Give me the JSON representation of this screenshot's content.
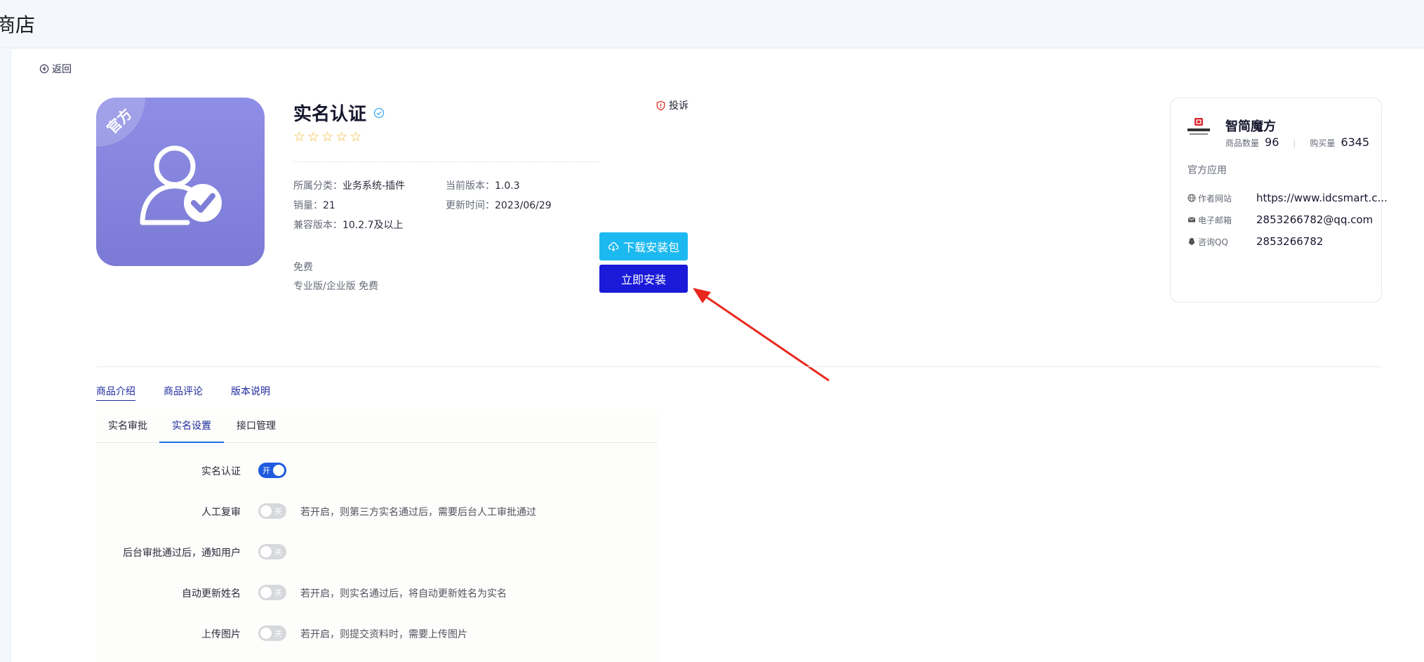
{
  "header": {
    "title": "商店"
  },
  "back": {
    "label": "返回"
  },
  "product": {
    "badge": "官方",
    "title": "实名认证",
    "rating": 0,
    "rating_max": 5,
    "complain_label": "投诉",
    "meta": {
      "category_key": "所属分类：",
      "category_value": "业务系统-插件",
      "version_key": "当前版本：",
      "version_value": "1.0.3",
      "sales_key": "销量：",
      "sales_value": "21",
      "updated_key": "更新时间：",
      "updated_value": "2023/06/29",
      "compat_key": "兼容版本：",
      "compat_value": "10.2.7及以上"
    },
    "price_free": "免费",
    "price_editions": "专业版/企业版 免费",
    "download_label": "下载安装包",
    "install_label": "立即安装"
  },
  "vendor": {
    "name": "智简魔方",
    "products_label": "商品数量",
    "products_count": "96",
    "buyers_label": "购买量",
    "buyers_count": "6345",
    "tag": "官方应用",
    "website_label": "作者网站",
    "website_value": "https://www.idcsmart.c...",
    "email_label": "电子邮箱",
    "email_value": "2853266782@qq.com",
    "qq_label": "咨询QQ",
    "qq_value": "2853266782"
  },
  "tabs": {
    "intro": "商品介绍",
    "reviews": "商品评论",
    "changelog": "版本说明"
  },
  "subtabs": {
    "approve": "实名审批",
    "settings": "实名设置",
    "api": "接口管理"
  },
  "settings": [
    {
      "label": "实名认证",
      "state": "开",
      "hint": ""
    },
    {
      "label": "人工复审",
      "state": "关",
      "hint": "若开启，则第三方实名通过后，需要后台人工审批通过"
    },
    {
      "label": "后台审批通过后，通知用户",
      "state": "关",
      "hint": ""
    },
    {
      "label": "自动更新姓名",
      "state": "关",
      "hint": "若开启，则实名通过后，将自动更新姓名为实名"
    },
    {
      "label": "上传图片",
      "state": "关",
      "hint": "若开启，则提交资料时，需要上传图片"
    }
  ],
  "colors": {
    "accent": "#1a1ad8",
    "download": "#1cb9f0",
    "toggle_on": "#1e5ae0",
    "icon_bg": "#8585de",
    "arrow": "#e8281e"
  }
}
